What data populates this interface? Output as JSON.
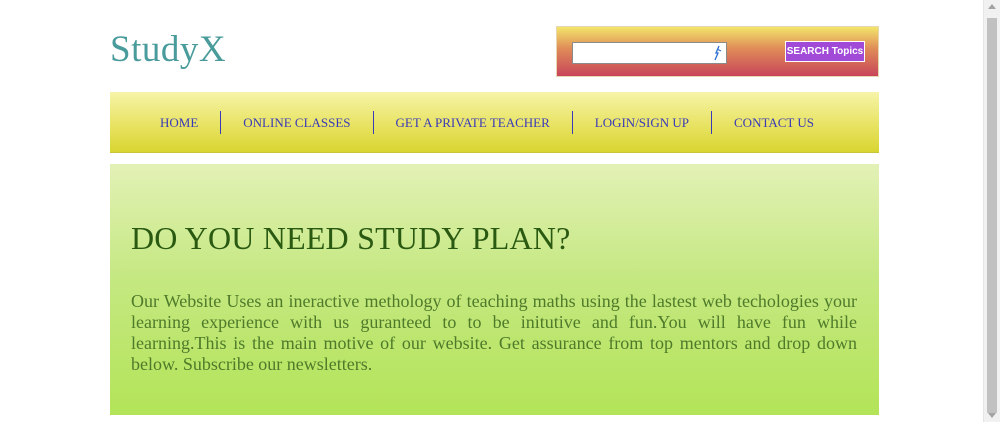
{
  "header": {
    "logo_text": "StudyX"
  },
  "search": {
    "value": "",
    "placeholder": "",
    "button_label": "SEARCH Topics",
    "field_icon": "pen-icon"
  },
  "nav": {
    "items": [
      {
        "label": "HOME"
      },
      {
        "label": "ONLINE CLASSES"
      },
      {
        "label": "GET A PRIVATE TEACHER"
      },
      {
        "label": "LOGIN/SIGN UP"
      },
      {
        "label": "CONTACT US"
      }
    ]
  },
  "hero": {
    "title": "DO YOU NEED STUDY PLAN?",
    "body": "Our Website Uses an ineractive methology of teaching maths using the lastest web techologies your learning experience with us guranteed to to be initutive and fun.You will have fun while learning.This is the main motive of our website. Get assurance from top mentors and drop down below. Subscribe our newsletters."
  },
  "colors": {
    "logo": "#4a9b9b",
    "nav_text": "#3a3ab8",
    "hero_title": "#2a5a12",
    "hero_text": "#4e7a2a",
    "search_button": "#a14ad8"
  }
}
